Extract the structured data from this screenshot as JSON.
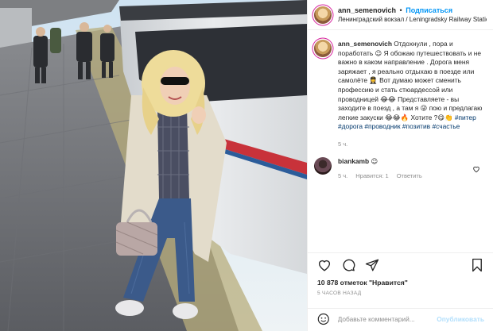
{
  "post": {
    "username": "ann_semenovich",
    "separator": "•",
    "follow_label": "Подписаться",
    "location": "Ленинградский вокзал / Leningradsky Railway Station"
  },
  "caption": {
    "username": "ann_semenovich",
    "text": "Отдохнули , пора и поработать 😉 Я обожаю путешествовать и не важно в каком направление . Дорога меня заряжает , я реально отдыхаю в поезде или самолёте 👩‍✈️ Вот думаю может сменить профессию и стать стюардессой или проводницей 😂😂 Представляете - вы заходите в поезд , а там я 😜 пою и предлагаю легкие закуски 😂😂🔥 Хотите ?😋👏",
    "hashtags": "#питер #дорога #проводник #позитив #счастье",
    "time": "5 ч."
  },
  "comment": {
    "username": "biankamb",
    "text": "😉",
    "time": "5 ч.",
    "like_label": "Нравится: 1",
    "reply_label": "Ответить"
  },
  "actions": {
    "likes": "10 878 отметок \"Нравится\"",
    "ago": "5 часов назад",
    "comment_placeholder": "Добавьте комментарий...",
    "publish_label": "Опубликовать"
  },
  "colors": {
    "follow": "#0095f6",
    "muted": "#8e8e8e",
    "hashtag": "#00376b",
    "publish_disabled": "#b2dffc"
  }
}
